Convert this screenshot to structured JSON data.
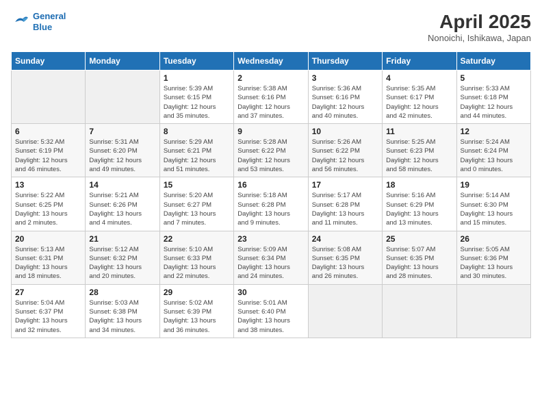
{
  "logo": {
    "line1": "General",
    "line2": "Blue"
  },
  "title": "April 2025",
  "location": "Nonoichi, Ishikawa, Japan",
  "days_of_week": [
    "Sunday",
    "Monday",
    "Tuesday",
    "Wednesday",
    "Thursday",
    "Friday",
    "Saturday"
  ],
  "weeks": [
    [
      {
        "num": "",
        "info": ""
      },
      {
        "num": "",
        "info": ""
      },
      {
        "num": "1",
        "info": "Sunrise: 5:39 AM\nSunset: 6:15 PM\nDaylight: 12 hours\nand 35 minutes."
      },
      {
        "num": "2",
        "info": "Sunrise: 5:38 AM\nSunset: 6:16 PM\nDaylight: 12 hours\nand 37 minutes."
      },
      {
        "num": "3",
        "info": "Sunrise: 5:36 AM\nSunset: 6:16 PM\nDaylight: 12 hours\nand 40 minutes."
      },
      {
        "num": "4",
        "info": "Sunrise: 5:35 AM\nSunset: 6:17 PM\nDaylight: 12 hours\nand 42 minutes."
      },
      {
        "num": "5",
        "info": "Sunrise: 5:33 AM\nSunset: 6:18 PM\nDaylight: 12 hours\nand 44 minutes."
      }
    ],
    [
      {
        "num": "6",
        "info": "Sunrise: 5:32 AM\nSunset: 6:19 PM\nDaylight: 12 hours\nand 46 minutes."
      },
      {
        "num": "7",
        "info": "Sunrise: 5:31 AM\nSunset: 6:20 PM\nDaylight: 12 hours\nand 49 minutes."
      },
      {
        "num": "8",
        "info": "Sunrise: 5:29 AM\nSunset: 6:21 PM\nDaylight: 12 hours\nand 51 minutes."
      },
      {
        "num": "9",
        "info": "Sunrise: 5:28 AM\nSunset: 6:22 PM\nDaylight: 12 hours\nand 53 minutes."
      },
      {
        "num": "10",
        "info": "Sunrise: 5:26 AM\nSunset: 6:22 PM\nDaylight: 12 hours\nand 56 minutes."
      },
      {
        "num": "11",
        "info": "Sunrise: 5:25 AM\nSunset: 6:23 PM\nDaylight: 12 hours\nand 58 minutes."
      },
      {
        "num": "12",
        "info": "Sunrise: 5:24 AM\nSunset: 6:24 PM\nDaylight: 13 hours\nand 0 minutes."
      }
    ],
    [
      {
        "num": "13",
        "info": "Sunrise: 5:22 AM\nSunset: 6:25 PM\nDaylight: 13 hours\nand 2 minutes."
      },
      {
        "num": "14",
        "info": "Sunrise: 5:21 AM\nSunset: 6:26 PM\nDaylight: 13 hours\nand 4 minutes."
      },
      {
        "num": "15",
        "info": "Sunrise: 5:20 AM\nSunset: 6:27 PM\nDaylight: 13 hours\nand 7 minutes."
      },
      {
        "num": "16",
        "info": "Sunrise: 5:18 AM\nSunset: 6:28 PM\nDaylight: 13 hours\nand 9 minutes."
      },
      {
        "num": "17",
        "info": "Sunrise: 5:17 AM\nSunset: 6:28 PM\nDaylight: 13 hours\nand 11 minutes."
      },
      {
        "num": "18",
        "info": "Sunrise: 5:16 AM\nSunset: 6:29 PM\nDaylight: 13 hours\nand 13 minutes."
      },
      {
        "num": "19",
        "info": "Sunrise: 5:14 AM\nSunset: 6:30 PM\nDaylight: 13 hours\nand 15 minutes."
      }
    ],
    [
      {
        "num": "20",
        "info": "Sunrise: 5:13 AM\nSunset: 6:31 PM\nDaylight: 13 hours\nand 18 minutes."
      },
      {
        "num": "21",
        "info": "Sunrise: 5:12 AM\nSunset: 6:32 PM\nDaylight: 13 hours\nand 20 minutes."
      },
      {
        "num": "22",
        "info": "Sunrise: 5:10 AM\nSunset: 6:33 PM\nDaylight: 13 hours\nand 22 minutes."
      },
      {
        "num": "23",
        "info": "Sunrise: 5:09 AM\nSunset: 6:34 PM\nDaylight: 13 hours\nand 24 minutes."
      },
      {
        "num": "24",
        "info": "Sunrise: 5:08 AM\nSunset: 6:35 PM\nDaylight: 13 hours\nand 26 minutes."
      },
      {
        "num": "25",
        "info": "Sunrise: 5:07 AM\nSunset: 6:35 PM\nDaylight: 13 hours\nand 28 minutes."
      },
      {
        "num": "26",
        "info": "Sunrise: 5:05 AM\nSunset: 6:36 PM\nDaylight: 13 hours\nand 30 minutes."
      }
    ],
    [
      {
        "num": "27",
        "info": "Sunrise: 5:04 AM\nSunset: 6:37 PM\nDaylight: 13 hours\nand 32 minutes."
      },
      {
        "num": "28",
        "info": "Sunrise: 5:03 AM\nSunset: 6:38 PM\nDaylight: 13 hours\nand 34 minutes."
      },
      {
        "num": "29",
        "info": "Sunrise: 5:02 AM\nSunset: 6:39 PM\nDaylight: 13 hours\nand 36 minutes."
      },
      {
        "num": "30",
        "info": "Sunrise: 5:01 AM\nSunset: 6:40 PM\nDaylight: 13 hours\nand 38 minutes."
      },
      {
        "num": "",
        "info": ""
      },
      {
        "num": "",
        "info": ""
      },
      {
        "num": "",
        "info": ""
      }
    ]
  ]
}
